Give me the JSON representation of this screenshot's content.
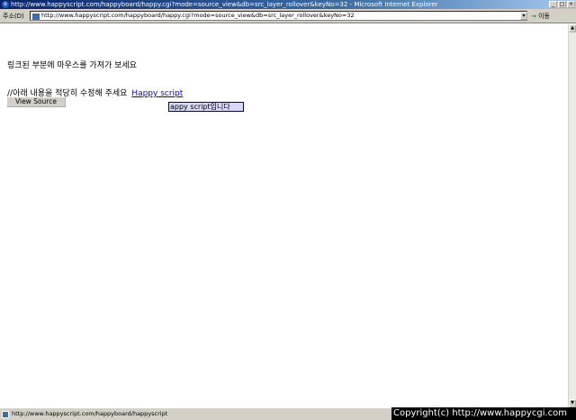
{
  "window": {
    "title": "http://www.happyscript.com/happyboard/happy.cgi?mode=source_view&db=src_layer_rollover&keyNo=32 - Microsoft Internet Explorer",
    "buttons": [
      "_",
      "□",
      "×"
    ]
  },
  "address_bar": {
    "label": "주소(D)",
    "url": "http://www.happyscript.com/happyboard/happy.cgi?mode=source_view&db=src_layer_rollover&keyNo=32",
    "dropdown": "▾",
    "go_arrow": "→",
    "go_label": "이동"
  },
  "content": {
    "instruction": "링크된 부분에 마우스를 가져가 보세요",
    "comment_text": "//아래 내용을 적당히 수정해 주세요",
    "link_text": "Happy script",
    "view_source_label": "View Source",
    "layer_popup_text": "appy script입니다"
  },
  "status_bar": {
    "text": "http://www.happyscript.com/happyboard/happyscript",
    "copyright": "Copyright(c) http://www.happycgi.com"
  },
  "colors": {
    "title_bar": "#0a246a",
    "chrome": "#d4d0c8",
    "link": "#0000ee",
    "popup_bg": "#d8d8f8"
  }
}
